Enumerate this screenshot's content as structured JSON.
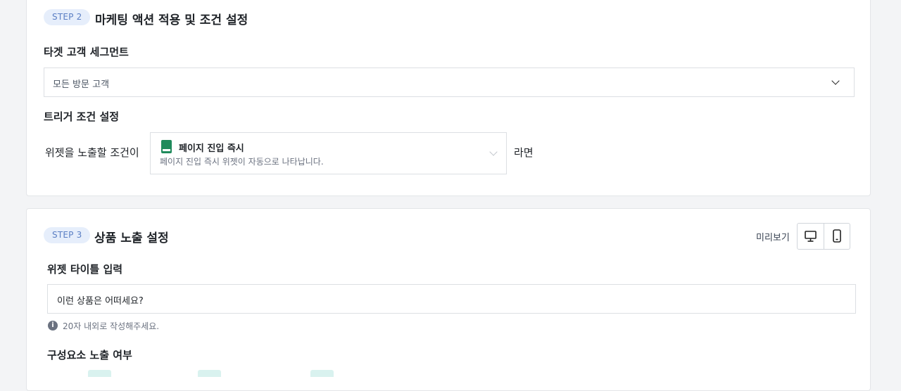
{
  "step2": {
    "badge": "STEP 2",
    "title": "마케팅 액션 적용 및 조건 설정",
    "segment": {
      "label": "타겟 고객 세그먼트",
      "selected": "모든 방문 고객"
    },
    "trigger": {
      "label": "트리거 조건 설정",
      "prefix": "위젯을 노출할 조건이",
      "option_title": "페이지 진입 즉시",
      "option_desc": "페이지 진입 즉시 위젯이 자동으로 나타납니다.",
      "suffix": "라면"
    }
  },
  "step3": {
    "badge": "STEP 3",
    "title": "상품 노출 설정",
    "preview_label": "미리보기",
    "widget_title": {
      "label": "위젯 타이틀 입력",
      "value": "이런 상품은 어떠세요?",
      "help": "20자 내외로 작성해주세요."
    },
    "components_label": "구성요소 노출 여부"
  },
  "colors": {
    "badge_bg": "#e6eefb",
    "badge_text": "#5b7fc4",
    "trigger_icon": "#1f8a5b",
    "toggle_stub": "#d9f2ef"
  },
  "icons": {
    "dropdown": "chevron-down-icon",
    "trigger": "book-icon",
    "desktop": "monitor-icon",
    "mobile": "smartphone-icon",
    "help": "info-icon"
  }
}
